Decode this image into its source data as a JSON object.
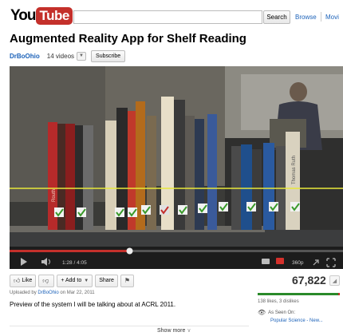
{
  "header": {
    "logo_you": "You",
    "logo_tube": "Tube",
    "search_placeholder": "",
    "search_button": "Search",
    "nav_browse": "Browse",
    "nav_movies": "Movi"
  },
  "video": {
    "title": "Augmented Reality App for Shelf Reading",
    "channel": "DrBoOhio",
    "video_count": "14 videos",
    "subscribe_label": "Subscribe",
    "dropdown_icon": "chevron-down-icon",
    "player": {
      "time_current": "1:28",
      "time_total": "4:05",
      "time_display": "1:28 / 4:05",
      "progress_fraction": 0.36,
      "quality": "360p",
      "book_labels": [
        "Routh",
        "Thomas Ruth"
      ],
      "icons": [
        "play-icon",
        "volume-icon",
        "captions-icon",
        "annotations-icon",
        "quality-icon",
        "popout-icon",
        "fullscreen-icon"
      ]
    }
  },
  "actions": {
    "like_label": "Like",
    "add_to_label": "+ Add to",
    "share_label": "Share",
    "icons": [
      "thumbs-up-icon",
      "thumbs-down-icon",
      "chevron-down-icon",
      "flag-icon"
    ]
  },
  "stats": {
    "views": "67,822",
    "likes_text": "138 likes, 3 dislikes",
    "like_fraction": 0.979,
    "as_seen_on": "As Seen On:",
    "seen_link": "Popular Science - New..."
  },
  "info": {
    "uploaded_prefix": "Uploaded by",
    "uploader": "DrBoOhio",
    "uploaded_date": "on Mar 22, 2011",
    "description": "Preview of the system I will be talking about at ACRL 2011.",
    "show_more": "Show more"
  },
  "colors": {
    "brand_red": "#c4302b",
    "link_blue": "#1c62b9",
    "like_green": "#2a8a2a",
    "scan_line": "#e8e83a"
  }
}
